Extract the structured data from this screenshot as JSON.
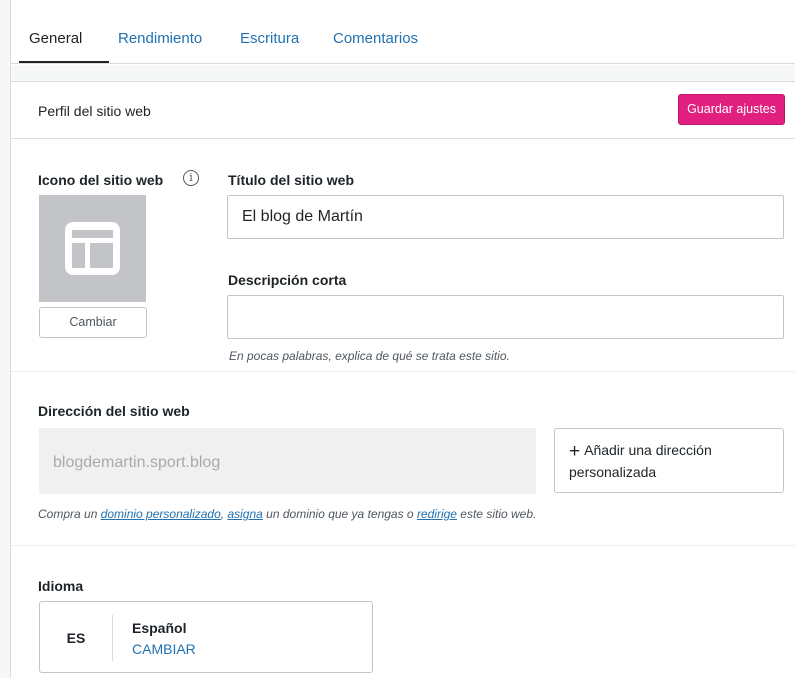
{
  "tabs": [
    {
      "label": "General",
      "active": true
    },
    {
      "label": "Rendimiento",
      "active": false
    },
    {
      "label": "Escritura",
      "active": false
    },
    {
      "label": "Comentarios",
      "active": false
    }
  ],
  "card": {
    "title": "Perfil del sitio web",
    "save_label": "Guardar ajustes"
  },
  "site_icon": {
    "label": "Icono del sitio web",
    "info_icon": "info-icon",
    "info_glyph": "i",
    "placeholder_icon": "layout-icon",
    "change_label": "Cambiar"
  },
  "site_title": {
    "label": "Título del sitio web",
    "value": "El blog de Martín"
  },
  "short_description": {
    "label": "Descripción corta",
    "value": "",
    "help": "En pocas palabras, explica de qué se trata este sitio."
  },
  "site_address": {
    "label": "Dirección del sitio web",
    "value": "blogdemartin.sport.blog",
    "add_button_plus": "+",
    "add_button_label": "Añadir una dirección personalizada",
    "help_1": "Compra un ",
    "link_custom_domain": "dominio personalizado",
    "help_2": ", ",
    "link_assign": "asigna",
    "help_3": " un dominio que ya tengas o ",
    "link_redirect": "redirige",
    "help_4": " este sitio web."
  },
  "language": {
    "label": "Idioma",
    "code": "ES",
    "name": "Español",
    "change_label": "CAMBIAR"
  },
  "colors": {
    "accent_button": "#e01f7f",
    "link": "#2271b1",
    "placeholder_box": "#c3c4c7"
  }
}
